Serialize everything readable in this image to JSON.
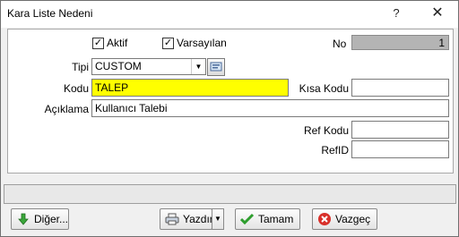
{
  "window": {
    "title": "Kara Liste Nedeni",
    "help_glyph": "?",
    "close_glyph": "✕"
  },
  "form": {
    "aktif": {
      "label": "Aktif",
      "checked": true
    },
    "varsayilan": {
      "label": "Varsayılan",
      "checked": true
    },
    "no": {
      "label": "No",
      "value": "1"
    },
    "tipi": {
      "label": "Tipi",
      "value": "CUSTOM"
    },
    "kodu": {
      "label": "Kodu",
      "value": "TALEP"
    },
    "kisa_kodu": {
      "label": "Kısa Kodu",
      "value": ""
    },
    "aciklama": {
      "label": "Açıklama",
      "value": "Kullanıcı Talebi"
    },
    "ref_kodu": {
      "label": "Ref Kodu",
      "value": ""
    },
    "ref_id": {
      "label": "RefID",
      "value": ""
    }
  },
  "buttons": {
    "diger": "Diğer...",
    "yazdir": "Yazdır",
    "tamam": "Tamam",
    "vazgec": "Vazgeç"
  },
  "colors": {
    "highlight_field": "#ffff00",
    "readonly_field": "#b4b4b4",
    "ok_green": "#2e9e2e",
    "cancel_red": "#d8302a"
  },
  "icons": [
    "help-icon",
    "close-icon",
    "checkmark-icon",
    "dropdown-arrow-icon",
    "lookup-icon",
    "arrow-down-icon",
    "printer-icon",
    "ok-checkmark-icon",
    "cancel-x-icon"
  ]
}
